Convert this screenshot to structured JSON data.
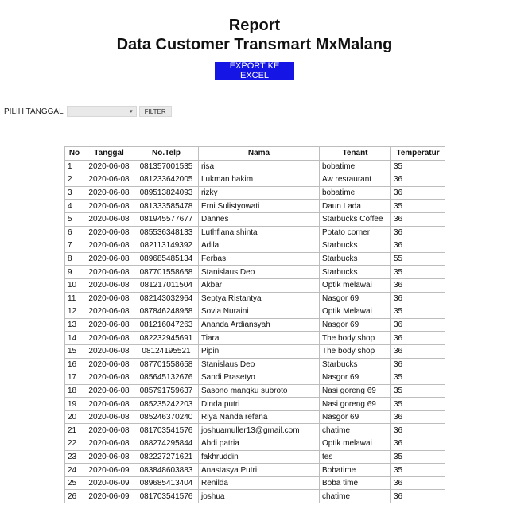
{
  "header": {
    "title": "Report",
    "subtitle": "Data Customer Transmart MxMalang"
  },
  "export_button": {
    "label": "EXPORT KE EXCEL"
  },
  "filter": {
    "label": "PILIH TANGGAL",
    "selected": "",
    "dropdown_icon": "▾",
    "button_label": "FILTER"
  },
  "table": {
    "headers": [
      "No",
      "Tanggal",
      "No.Telp",
      "Nama",
      "Tenant",
      "Temperatur"
    ],
    "rows": [
      [
        "1",
        "2020-06-08",
        "081357001535",
        "risa",
        "bobatime",
        "35"
      ],
      [
        "2",
        "2020-06-08",
        "081233642005",
        "Lukman hakim",
        "Aw resraurant",
        "36"
      ],
      [
        "3",
        "2020-06-08",
        "089513824093",
        "rizky",
        "bobatime",
        "36"
      ],
      [
        "4",
        "2020-06-08",
        "081333585478",
        "Erni Sulistyowati",
        "Daun Lada",
        "35"
      ],
      [
        "5",
        "2020-06-08",
        "081945577677",
        "Dannes",
        "Starbucks Coffee",
        "36"
      ],
      [
        "6",
        "2020-06-08",
        "085536348133",
        "Luthfiana shinta",
        "Potato corner",
        "36"
      ],
      [
        "7",
        "2020-06-08",
        "082113149392",
        "Adila",
        "Starbucks",
        "36"
      ],
      [
        "8",
        "2020-06-08",
        "089685485134",
        "Ferbas",
        "Starbucks",
        "55"
      ],
      [
        "9",
        "2020-06-08",
        "087701558658",
        "Stanislaus Deo",
        "Starbucks",
        "35"
      ],
      [
        "10",
        "2020-06-08",
        "081217011504",
        "Akbar",
        "Optik melawai",
        "36"
      ],
      [
        "11",
        "2020-06-08",
        "082143032964",
        "Septya Ristantya",
        "Nasgor 69",
        "36"
      ],
      [
        "12",
        "2020-06-08",
        "087846248958",
        "Sovia Nuraini",
        "Optik Melawai",
        "35"
      ],
      [
        "13",
        "2020-06-08",
        "081216047263",
        "Ananda Ardiansyah",
        "Nasgor 69",
        "36"
      ],
      [
        "14",
        "2020-06-08",
        "082232945691",
        "Tiara",
        "The body shop",
        "36"
      ],
      [
        "15",
        "2020-06-08",
        "08124195521",
        "Pipin",
        "The body shop",
        "36"
      ],
      [
        "16",
        "2020-06-08",
        "087701558658",
        "Stanislaus Deo",
        "Starbucks",
        "36"
      ],
      [
        "17",
        "2020-06-08",
        "085645132676",
        "Sandi Prasetyo",
        "Nasgor 69",
        "35"
      ],
      [
        "18",
        "2020-06-08",
        "085791759637",
        "Sasono mangku subroto",
        "Nasi goreng 69",
        "35"
      ],
      [
        "19",
        "2020-06-08",
        "085235242203",
        "Dinda putri",
        "Nasi goreng 69",
        "35"
      ],
      [
        "20",
        "2020-06-08",
        "085246370240",
        "Riya Nanda refana",
        "Nasgor 69",
        "36"
      ],
      [
        "21",
        "2020-06-08",
        "081703541576",
        "joshuamuller13@gmail.com",
        "chatime",
        "36"
      ],
      [
        "22",
        "2020-06-08",
        "088274295844",
        "Abdi patria",
        "Optik melawai",
        "36"
      ],
      [
        "23",
        "2020-06-08",
        "082227271621",
        "fakhruddin",
        "tes",
        "35"
      ],
      [
        "24",
        "2020-06-09",
        "083848603883",
        "Anastasya Putri",
        "Bobatime",
        "35"
      ],
      [
        "25",
        "2020-06-09",
        "089685413404",
        "Renilda",
        "Boba time",
        "36"
      ],
      [
        "26",
        "2020-06-09",
        "081703541576",
        "joshua",
        "chatime",
        "36"
      ]
    ]
  }
}
